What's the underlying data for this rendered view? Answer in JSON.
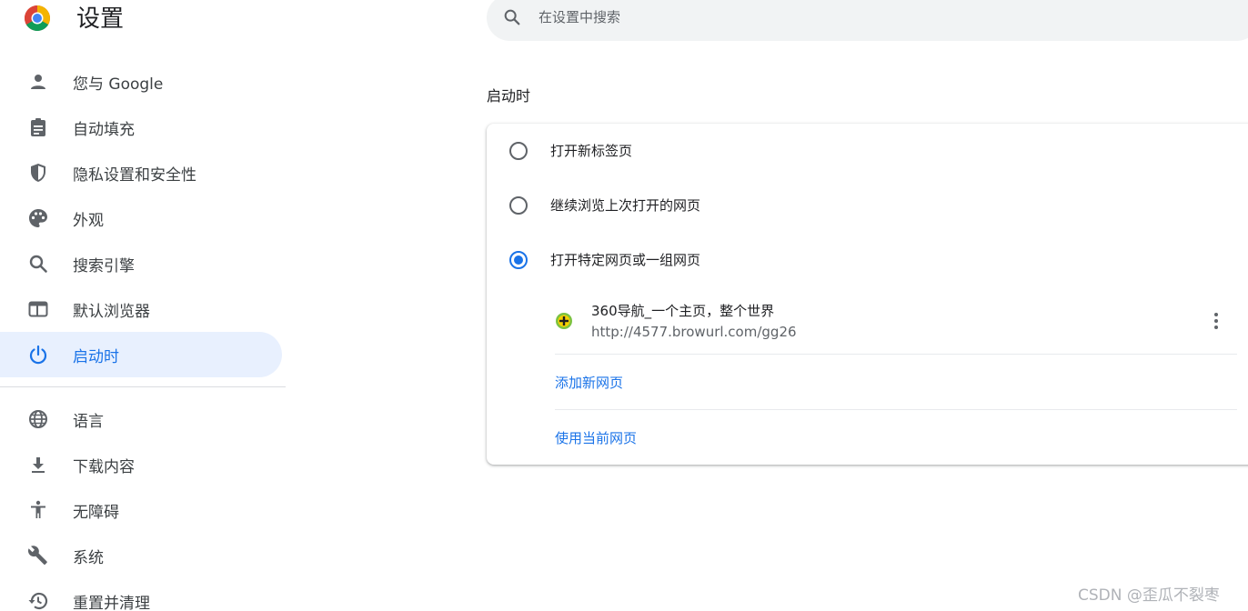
{
  "header": {
    "title": "设置",
    "logo_icon": "chrome-logo-icon",
    "search": {
      "placeholder": "在设置中搜索",
      "value": "",
      "icon": "search-icon"
    }
  },
  "sidebar": {
    "items": [
      {
        "label": "您与 Google",
        "icon": "person-icon",
        "active": false
      },
      {
        "label": "自动填充",
        "icon": "clipboard-icon",
        "active": false
      },
      {
        "label": "隐私设置和安全性",
        "icon": "shield-icon",
        "active": false
      },
      {
        "label": "外观",
        "icon": "palette-icon",
        "active": false
      },
      {
        "label": "搜索引擎",
        "icon": "search-icon",
        "active": false
      },
      {
        "label": "默认浏览器",
        "icon": "browser-window-icon",
        "active": false
      },
      {
        "label": "启动时",
        "icon": "power-icon",
        "active": true
      }
    ],
    "items2": [
      {
        "label": "语言",
        "icon": "globe-icon"
      },
      {
        "label": "下载内容",
        "icon": "download-icon"
      },
      {
        "label": "无障碍",
        "icon": "accessibility-icon"
      },
      {
        "label": "系统",
        "icon": "wrench-icon"
      },
      {
        "label": "重置并清理",
        "icon": "restore-icon"
      }
    ]
  },
  "main": {
    "section_title": "启动时",
    "options": [
      {
        "label": "打开新标签页",
        "checked": false
      },
      {
        "label": "继续浏览上次打开的网页",
        "checked": false
      },
      {
        "label": "打开特定网页或一组网页",
        "checked": true
      }
    ],
    "pages": [
      {
        "title": "360导航_一个主页，整个世界",
        "url": "http://4577.browurl.com/gg26",
        "favicon": "360-favicon-icon"
      }
    ],
    "add_page_label": "添加新网页",
    "use_current_label": "使用当前网页"
  },
  "watermark": "CSDN @歪瓜不裂枣",
  "colors": {
    "accent": "#1a73e8",
    "active_bg": "#e8f0fe",
    "search_bg": "#f1f3f4"
  }
}
